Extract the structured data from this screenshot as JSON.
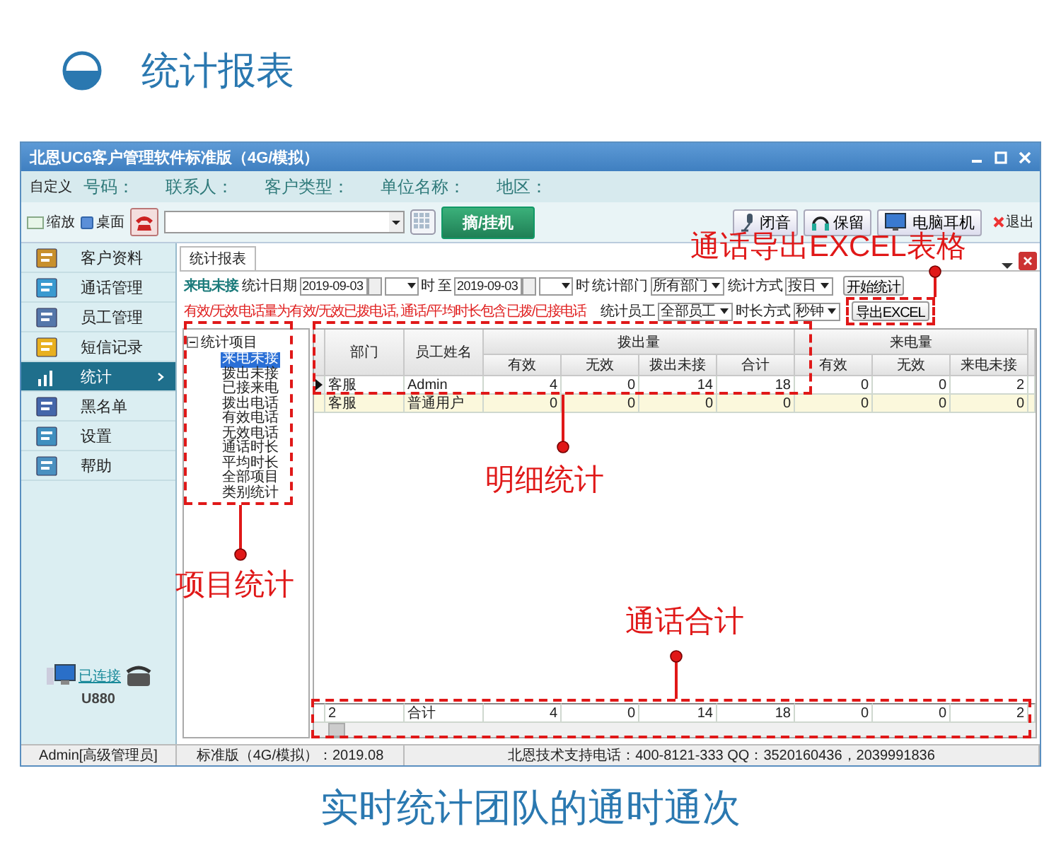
{
  "header": {
    "title": "统计报表"
  },
  "window": {
    "title": "北恩UC6客户管理软件标准版（4G/模拟）"
  },
  "search_bar": {
    "labels": [
      "自定义",
      "号码：",
      "联系人：",
      "客户类型：",
      "单位名称：",
      "地区："
    ]
  },
  "toolbar": {
    "zoom": "缩放",
    "desktop": "桌面",
    "dial_button": "摘/挂机",
    "buttons": [
      {
        "label": "闭音"
      },
      {
        "label": "保留"
      },
      {
        "label": "电脑耳机"
      }
    ],
    "exit": "退出"
  },
  "sidebar": {
    "items": [
      {
        "label": "客户资料",
        "selected": false
      },
      {
        "label": "通话管理",
        "selected": false
      },
      {
        "label": "员工管理",
        "selected": false
      },
      {
        "label": "短信记录",
        "selected": false
      },
      {
        "label": "统计",
        "selected": true
      },
      {
        "label": "黑名单",
        "selected": false
      },
      {
        "label": "设置",
        "selected": false
      },
      {
        "label": "帮助",
        "selected": false
      }
    ],
    "connection": {
      "status": "已连接",
      "device": "U880"
    }
  },
  "report": {
    "tab": "统计报表",
    "mode": "来电未接",
    "date_label": "统计日期",
    "date_from": "2019-09-03",
    "hour_label": "时",
    "to_label": "至",
    "date_to": "2019-09-03",
    "hour_label_2": "时",
    "department_label": "统计部门",
    "department": "所有部门",
    "method_label": "统计方式",
    "method": "按日",
    "start_button": "开始统计",
    "note": "有效/无效电话量为有效/无效已拨电话, 通话/平均时长包含已拨/已接电话",
    "staff_label": "统计员工",
    "staff": "全部员工",
    "duration_label": "时长方式",
    "duration": "秒钟",
    "export_button": "导出EXCEL"
  },
  "tree": {
    "label": "统计项目",
    "expanded": true,
    "children": [
      {
        "label": "来电未接",
        "selected": true
      },
      {
        "label": "拨出未接",
        "selected": false
      },
      {
        "label": "已接来电",
        "selected": false
      },
      {
        "label": "拨出电话",
        "selected": false
      },
      {
        "label": "有效电话",
        "selected": false
      },
      {
        "label": "无效电话",
        "selected": false
      },
      {
        "label": "通话时长",
        "selected": false
      },
      {
        "label": "平均时长",
        "selected": false
      },
      {
        "label": "全部项目",
        "selected": false
      },
      {
        "label": "类别统计",
        "selected": false
      }
    ]
  },
  "table": {
    "columns": [
      {
        "label": "部门"
      },
      {
        "label": "员工姓名"
      },
      {
        "label": "有效",
        "group": "拨出量"
      },
      {
        "label": "无效"
      },
      {
        "label": "拨出未接"
      },
      {
        "label": "合计"
      },
      {
        "label": "有效",
        "group": "来电量"
      },
      {
        "label": "无效"
      },
      {
        "label": "来电未接"
      }
    ],
    "rows": [
      {
        "selected": true,
        "cells": [
          "客服",
          "Admin",
          "4",
          "0",
          "14",
          "18",
          "0",
          "0",
          "2"
        ]
      },
      {
        "selected": false,
        "cells": [
          "客服",
          "普通用户",
          "0",
          "0",
          "0",
          "0",
          "0",
          "0",
          "0"
        ]
      }
    ],
    "total": {
      "count": "2",
      "label": "合计",
      "values": [
        "4",
        "0",
        "14",
        "18",
        "0",
        "0",
        "2"
      ]
    }
  },
  "status_bar": [
    "Admin[高级管理员]",
    "标准版（4G/模拟）：2019.08",
    "北恩技术支持电话：400-8121-333  QQ：3520160436，2039991836"
  ],
  "annotations": [
    {
      "label": "通话导出EXCEL表格"
    },
    {
      "label": "明细统计"
    },
    {
      "label": "项目统计"
    },
    {
      "label": "通话合计"
    }
  ],
  "caption": "实时统计团队的通时通次"
}
